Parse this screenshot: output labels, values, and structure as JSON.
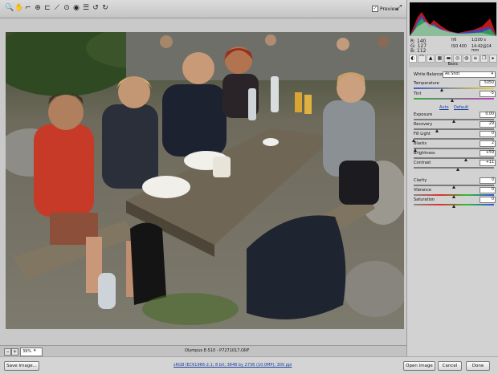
{
  "toolbar": {
    "tools": [
      "zoom-icon",
      "hand-icon",
      "eyedropper-icon",
      "color-sampler-icon",
      "crop-icon",
      "straighten-icon",
      "retouch-icon",
      "red-eye-icon",
      "preferences-icon",
      "rotate-left-icon",
      "rotate-right-icon"
    ],
    "tool_glyphs": [
      "🔍",
      "✋",
      "⌐",
      "⊕",
      "⊏",
      "⟋",
      "⊙",
      "◉",
      "☰",
      "↺",
      "↻"
    ],
    "preview_label": "Preview",
    "preview_checked": true
  },
  "status": {
    "zoom": "39%",
    "filename": "Olympus E-510 - P7271017.ORF"
  },
  "footer": {
    "save_label": "Save Image...",
    "workflow": "sRGB IEC61966-2.1; 8 bit; 3648 by 2736 (10.0MP); 300 ppi",
    "open_label": "Open Image",
    "cancel_label": "Cancel",
    "done_label": "Done"
  },
  "readout": {
    "r": "R: 140",
    "g": "G: 127",
    "b": "B: 112",
    "fstop": "f/6",
    "shutter": "1/200 s",
    "iso": "ISO 400",
    "focal": "14-42@14 mm"
  },
  "panel": {
    "section": "Basic",
    "white_balance_label": "White Balance:",
    "white_balance_value": "As Shot",
    "auto_label": "Auto",
    "default_label": "Default",
    "controls": [
      {
        "label": "Temperature",
        "value": "5050",
        "pos": 0.35
      },
      {
        "label": "Tint",
        "value": "-5",
        "pos": 0.48
      },
      {
        "label": "Exposure",
        "value": "0.00",
        "pos": 0.5
      },
      {
        "label": "Recovery",
        "value": "29",
        "pos": 0.29
      },
      {
        "label": "Fill Light",
        "value": "0",
        "pos": 0.0
      },
      {
        "label": "Blacks",
        "value": "2",
        "pos": 0.02
      },
      {
        "label": "Brightness",
        "value": "+59",
        "pos": 0.65
      },
      {
        "label": "Contrast",
        "value": "+11",
        "pos": 0.55
      },
      {
        "label": "Clarity",
        "value": "0",
        "pos": 0.5
      },
      {
        "label": "Vibrance",
        "value": "0",
        "pos": 0.5
      },
      {
        "label": "Saturation",
        "value": "0",
        "pos": 0.5
      }
    ]
  },
  "colors": {
    "accent_link": "#1a3fa0",
    "panel_bg": "#d2d2d2"
  }
}
